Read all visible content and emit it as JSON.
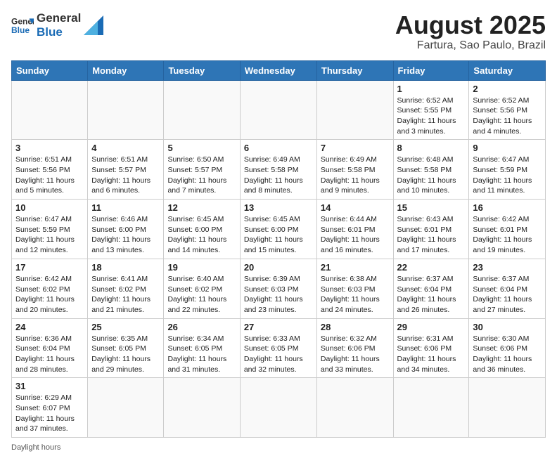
{
  "header": {
    "logo_general": "General",
    "logo_blue": "Blue",
    "title": "August 2025",
    "subtitle": "Fartura, Sao Paulo, Brazil"
  },
  "weekdays": [
    "Sunday",
    "Monday",
    "Tuesday",
    "Wednesday",
    "Thursday",
    "Friday",
    "Saturday"
  ],
  "weeks": [
    [
      {
        "day": "",
        "info": ""
      },
      {
        "day": "",
        "info": ""
      },
      {
        "day": "",
        "info": ""
      },
      {
        "day": "",
        "info": ""
      },
      {
        "day": "",
        "info": ""
      },
      {
        "day": "1",
        "info": "Sunrise: 6:52 AM\nSunset: 5:55 PM\nDaylight: 11 hours and 3 minutes."
      },
      {
        "day": "2",
        "info": "Sunrise: 6:52 AM\nSunset: 5:56 PM\nDaylight: 11 hours and 4 minutes."
      }
    ],
    [
      {
        "day": "3",
        "info": "Sunrise: 6:51 AM\nSunset: 5:56 PM\nDaylight: 11 hours and 5 minutes."
      },
      {
        "day": "4",
        "info": "Sunrise: 6:51 AM\nSunset: 5:57 PM\nDaylight: 11 hours and 6 minutes."
      },
      {
        "day": "5",
        "info": "Sunrise: 6:50 AM\nSunset: 5:57 PM\nDaylight: 11 hours and 7 minutes."
      },
      {
        "day": "6",
        "info": "Sunrise: 6:49 AM\nSunset: 5:58 PM\nDaylight: 11 hours and 8 minutes."
      },
      {
        "day": "7",
        "info": "Sunrise: 6:49 AM\nSunset: 5:58 PM\nDaylight: 11 hours and 9 minutes."
      },
      {
        "day": "8",
        "info": "Sunrise: 6:48 AM\nSunset: 5:58 PM\nDaylight: 11 hours and 10 minutes."
      },
      {
        "day": "9",
        "info": "Sunrise: 6:47 AM\nSunset: 5:59 PM\nDaylight: 11 hours and 11 minutes."
      }
    ],
    [
      {
        "day": "10",
        "info": "Sunrise: 6:47 AM\nSunset: 5:59 PM\nDaylight: 11 hours and 12 minutes."
      },
      {
        "day": "11",
        "info": "Sunrise: 6:46 AM\nSunset: 6:00 PM\nDaylight: 11 hours and 13 minutes."
      },
      {
        "day": "12",
        "info": "Sunrise: 6:45 AM\nSunset: 6:00 PM\nDaylight: 11 hours and 14 minutes."
      },
      {
        "day": "13",
        "info": "Sunrise: 6:45 AM\nSunset: 6:00 PM\nDaylight: 11 hours and 15 minutes."
      },
      {
        "day": "14",
        "info": "Sunrise: 6:44 AM\nSunset: 6:01 PM\nDaylight: 11 hours and 16 minutes."
      },
      {
        "day": "15",
        "info": "Sunrise: 6:43 AM\nSunset: 6:01 PM\nDaylight: 11 hours and 17 minutes."
      },
      {
        "day": "16",
        "info": "Sunrise: 6:42 AM\nSunset: 6:01 PM\nDaylight: 11 hours and 19 minutes."
      }
    ],
    [
      {
        "day": "17",
        "info": "Sunrise: 6:42 AM\nSunset: 6:02 PM\nDaylight: 11 hours and 20 minutes."
      },
      {
        "day": "18",
        "info": "Sunrise: 6:41 AM\nSunset: 6:02 PM\nDaylight: 11 hours and 21 minutes."
      },
      {
        "day": "19",
        "info": "Sunrise: 6:40 AM\nSunset: 6:02 PM\nDaylight: 11 hours and 22 minutes."
      },
      {
        "day": "20",
        "info": "Sunrise: 6:39 AM\nSunset: 6:03 PM\nDaylight: 11 hours and 23 minutes."
      },
      {
        "day": "21",
        "info": "Sunrise: 6:38 AM\nSunset: 6:03 PM\nDaylight: 11 hours and 24 minutes."
      },
      {
        "day": "22",
        "info": "Sunrise: 6:37 AM\nSunset: 6:04 PM\nDaylight: 11 hours and 26 minutes."
      },
      {
        "day": "23",
        "info": "Sunrise: 6:37 AM\nSunset: 6:04 PM\nDaylight: 11 hours and 27 minutes."
      }
    ],
    [
      {
        "day": "24",
        "info": "Sunrise: 6:36 AM\nSunset: 6:04 PM\nDaylight: 11 hours and 28 minutes."
      },
      {
        "day": "25",
        "info": "Sunrise: 6:35 AM\nSunset: 6:05 PM\nDaylight: 11 hours and 29 minutes."
      },
      {
        "day": "26",
        "info": "Sunrise: 6:34 AM\nSunset: 6:05 PM\nDaylight: 11 hours and 31 minutes."
      },
      {
        "day": "27",
        "info": "Sunrise: 6:33 AM\nSunset: 6:05 PM\nDaylight: 11 hours and 32 minutes."
      },
      {
        "day": "28",
        "info": "Sunrise: 6:32 AM\nSunset: 6:06 PM\nDaylight: 11 hours and 33 minutes."
      },
      {
        "day": "29",
        "info": "Sunrise: 6:31 AM\nSunset: 6:06 PM\nDaylight: 11 hours and 34 minutes."
      },
      {
        "day": "30",
        "info": "Sunrise: 6:30 AM\nSunset: 6:06 PM\nDaylight: 11 hours and 36 minutes."
      }
    ],
    [
      {
        "day": "31",
        "info": "Sunrise: 6:29 AM\nSunset: 6:07 PM\nDaylight: 11 hours and 37 minutes."
      },
      {
        "day": "",
        "info": ""
      },
      {
        "day": "",
        "info": ""
      },
      {
        "day": "",
        "info": ""
      },
      {
        "day": "",
        "info": ""
      },
      {
        "day": "",
        "info": ""
      },
      {
        "day": "",
        "info": ""
      }
    ]
  ],
  "footer": {
    "note": "Daylight hours"
  }
}
